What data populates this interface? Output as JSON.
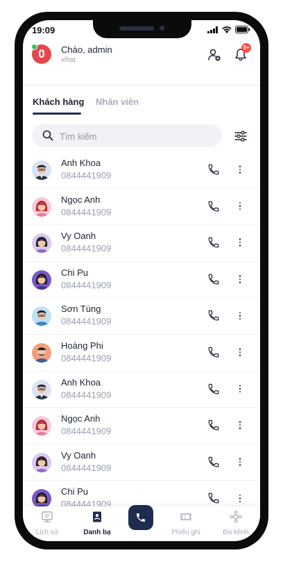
{
  "status_bar": {
    "time": "19:09"
  },
  "header": {
    "avatar_letter": "0",
    "greeting": "Chào, admin",
    "company": "vihat",
    "notification_badge": "9+"
  },
  "tabs": [
    {
      "label": "Khách hàng",
      "active": true
    },
    {
      "label": "Nhân viên",
      "active": false
    }
  ],
  "search": {
    "placeholder": "Tìm kiếm",
    "value": ""
  },
  "contacts": [
    {
      "name": "Anh Khoa",
      "phone": "0844441909",
      "avatar": "man-glasses"
    },
    {
      "name": "Ngọc Anh",
      "phone": "0844441909",
      "avatar": "woman-pink"
    },
    {
      "name": "Vy Oanh",
      "phone": "0844441909",
      "avatar": "woman-purple"
    },
    {
      "name": "Chi Pu",
      "phone": "0844441909",
      "avatar": "woman-violet"
    },
    {
      "name": "Sơn Tùng",
      "phone": "0844441909",
      "avatar": "man-blue"
    },
    {
      "name": "Hoàng Phi",
      "phone": "0844441909",
      "avatar": "man-orange"
    },
    {
      "name": "Anh Khoa",
      "phone": "0844441909",
      "avatar": "man-glasses"
    },
    {
      "name": "Ngọc Anh",
      "phone": "0844441909",
      "avatar": "woman-pink"
    },
    {
      "name": "Vy Oanh",
      "phone": "0844441909",
      "avatar": "woman-purple"
    },
    {
      "name": "Chi Pu",
      "phone": "0844441909",
      "avatar": "woman-violet"
    }
  ],
  "bottom_nav": [
    {
      "label": "Lịch sử",
      "icon": "history-icon",
      "active": false
    },
    {
      "label": "Danh bạ",
      "icon": "contacts-icon",
      "active": true
    },
    {
      "label": "",
      "icon": "call-icon",
      "active": false
    },
    {
      "label": "Phiếu ghi",
      "icon": "ticket-icon",
      "active": false
    },
    {
      "label": "Đa kênh",
      "icon": "omnichannel-icon",
      "active": false
    }
  ],
  "colors": {
    "primary": "#1e2d4f",
    "avatar_red": "#e4484d",
    "badge_red": "#ff4b4b",
    "online_green": "#3dbd63",
    "muted_text": "#9aa0ad"
  }
}
